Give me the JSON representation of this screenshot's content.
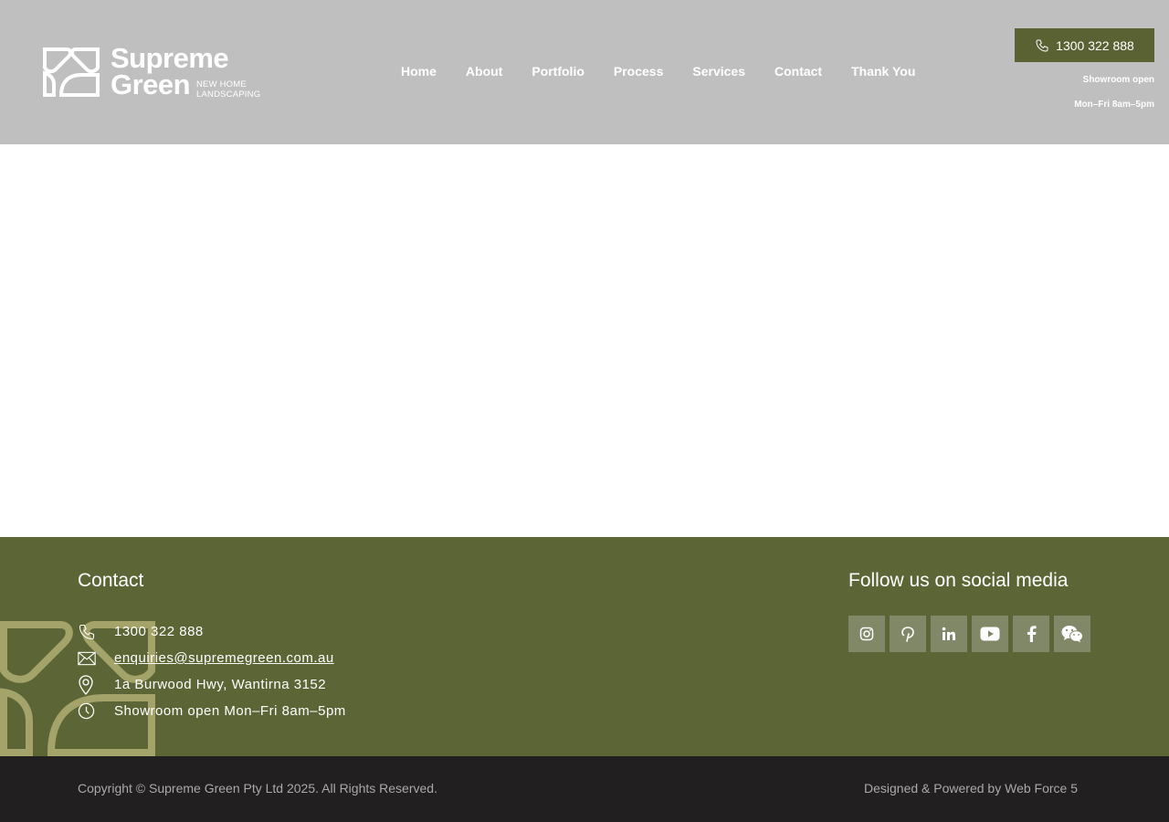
{
  "brand": {
    "name_line1": "Supreme",
    "name_line2": "Green",
    "tagline_line1": "NEW HOME",
    "tagline_line2": "LANDSCAPING"
  },
  "nav": {
    "items": [
      "Home",
      "About",
      "Portfolio",
      "Process",
      "Services",
      "Contact",
      "Thank You"
    ]
  },
  "header": {
    "phone": "1300 322 888",
    "hours_line1": "Showroom open",
    "hours_line2": "Mon–Fri 8am–5pm"
  },
  "footer": {
    "contact_title": "Contact",
    "phone": "1300 322 888",
    "email": "enquiries@supremegreen.com.au",
    "address": "1a Burwood Hwy, Wantirna 3152",
    "hours": "Showroom open Mon–Fri 8am–5pm",
    "social_title": "Follow us on social media",
    "social": [
      "instagram-icon",
      "pinterest-icon",
      "linkedin-icon",
      "youtube-icon",
      "facebook-icon",
      "wechat-icon"
    ]
  },
  "copyright": {
    "left": "Copyright © Supreme Green Pty Ltd 2025. All Rights Reserved.",
    "right": "Designed & Powered by Web Force 5"
  },
  "colors": {
    "header_bg": "#bfbfbf",
    "accent": "#5a6234",
    "footer_bg": "#5c6536",
    "bottom_bar": "#221f20"
  }
}
